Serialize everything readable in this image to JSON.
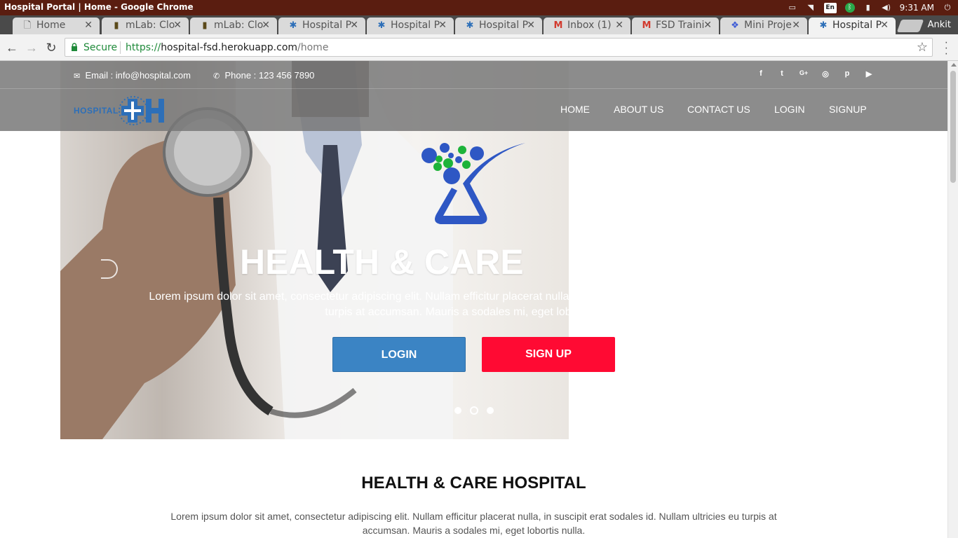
{
  "os": {
    "window_title": "Hospital Portal | Home - Google Chrome",
    "tray": {
      "lang": "En",
      "time": "9:31 AM"
    }
  },
  "browser": {
    "tabs": [
      {
        "label": "Home",
        "icon": "page-icon"
      },
      {
        "label": "mLab: Clo",
        "icon": "mlab-icon"
      },
      {
        "label": "mLab: Clo",
        "icon": "mlab-icon"
      },
      {
        "label": "Hospital P",
        "icon": "hospital-favicon"
      },
      {
        "label": "Hospital P",
        "icon": "hospital-favicon"
      },
      {
        "label": "Hospital P",
        "icon": "hospital-favicon"
      },
      {
        "label": "Inbox (1)",
        "icon": "gmail-icon"
      },
      {
        "label": "FSD Traini",
        "icon": "gmail-icon"
      },
      {
        "label": "Mini Proje",
        "icon": "dropbox-icon"
      },
      {
        "label": "Hospital P",
        "icon": "hospital-favicon",
        "active": true
      }
    ],
    "profile": "Ankit",
    "secure_label": "Secure",
    "url": {
      "scheme": "https://",
      "host": "hospital-fsd.herokuapp.com",
      "path": "/home"
    }
  },
  "page": {
    "topbar": {
      "email": "Email : info@hospital.com",
      "phone": "Phone : 123 456 7890",
      "social": [
        "facebook-icon",
        "twitter-icon",
        "google-plus-icon",
        "instagram-icon",
        "pinterest-icon",
        "youtube-icon"
      ]
    },
    "logo_text": "HOSPITAL",
    "nav": [
      "HOME",
      "ABOUT US",
      "CONTACT US",
      "LOGIN",
      "SIGNUP"
    ],
    "hero": {
      "title": "HEALTH & CARE",
      "text": "Lorem ipsum dolor sit amet, consectetur adipiscing elit. Nullam efficitur placerat nulla, in suscipit erat sodales id. Nullam ultricies eu turpis at accumsan. Mauris a sodales mi, eget lobortis nulla.",
      "login_btn": "LOGIN",
      "signup_btn": "SIGN UP",
      "slides": 3,
      "active_slide": 2
    },
    "section": {
      "title": "HEALTH & CARE HOSPITAL",
      "text": "Lorem ipsum dolor sit amet, consectetur adipiscing elit. Nullam efficitur placerat nulla, in suscipit erat sodales id. Nullam ultricies eu turpis at accumsan. Mauris a sodales mi, eget lobortis nulla."
    }
  },
  "colors": {
    "login": "#3b84c4",
    "signup": "#ff0a33",
    "brand": "#2d6fb8",
    "logo_green": "#1db33a"
  }
}
